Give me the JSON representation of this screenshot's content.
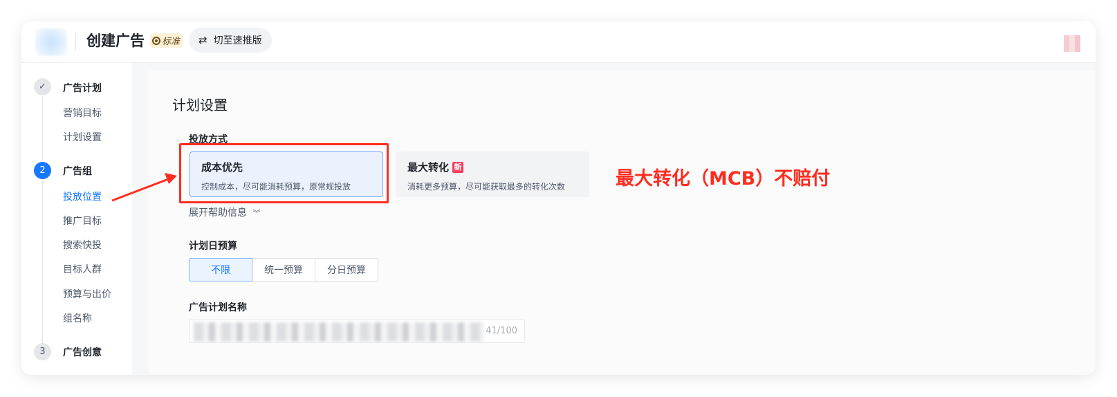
{
  "header": {
    "title": "创建广告",
    "badge": "标准",
    "switch_label": "切至速推版",
    "switch_icon": "swap-icon"
  },
  "sidebar": {
    "steps": [
      {
        "number": "✓",
        "label": "广告计划",
        "status": "done",
        "items": [
          "营销目标",
          "计划设置"
        ]
      },
      {
        "number": "2",
        "label": "广告组",
        "status": "active",
        "items": [
          "投放位置",
          "推广目标",
          "搜索快投",
          "目标人群",
          "预算与出价",
          "组名称"
        ]
      },
      {
        "number": "3",
        "label": "广告创意",
        "status": "todo",
        "items": []
      }
    ],
    "active_item": "投放位置"
  },
  "main": {
    "section_title": "计划设置",
    "delivery": {
      "label": "投放方式",
      "options": [
        {
          "title": "成本优先",
          "desc": "控制成本，尽可能消耗预算，原常规投放",
          "selected": true
        },
        {
          "title": "最大转化",
          "badge": "新",
          "desc": "消耗更多预算，尽可能获取最多的转化次数",
          "selected": false
        }
      ],
      "help_toggle": "展开帮助信息"
    },
    "budget": {
      "label": "计划日预算",
      "options": [
        "不限",
        "统一预算",
        "分日预算"
      ],
      "selected": "不限"
    },
    "plan_name": {
      "label": "广告计划名称",
      "char_count": "41/100"
    }
  },
  "annotation": {
    "text": "最大转化（MCB）不赔付",
    "color": "#ff2d1f"
  },
  "colors": {
    "accent": "#1677ff",
    "annotation_red": "#ff2d1f"
  }
}
